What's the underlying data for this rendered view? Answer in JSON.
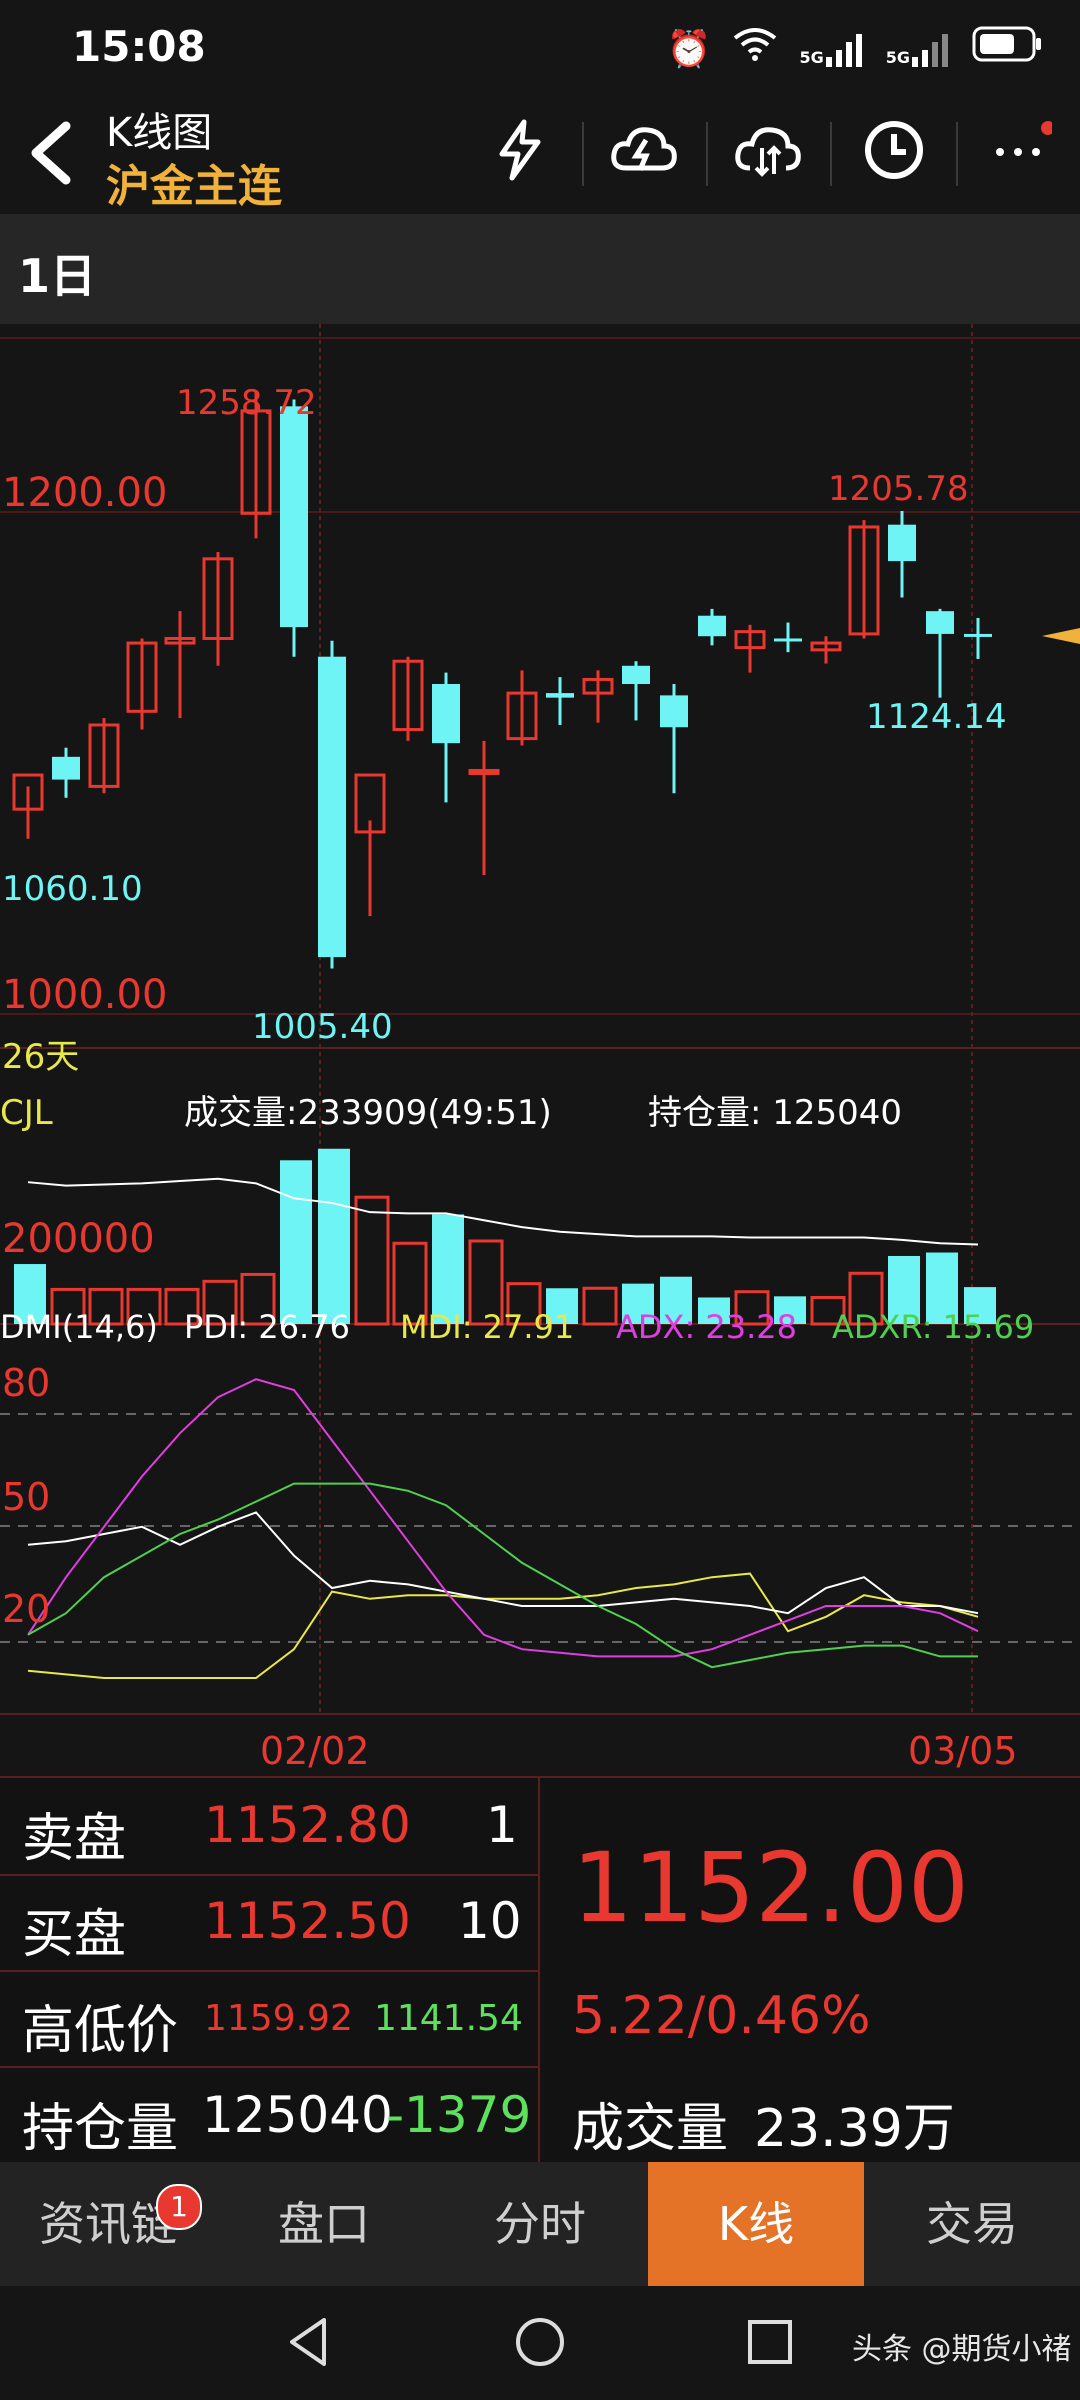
{
  "status_bar": {
    "time": "15:08",
    "network_1": "5G",
    "network_2": "5G"
  },
  "header": {
    "title": "K线图",
    "subtitle": "沪金主连",
    "icons": [
      "flash-icon",
      "cloud-lightning-icon",
      "cloud-sync-icon",
      "clock-icon",
      "more-icon"
    ]
  },
  "period": {
    "label": "1日"
  },
  "main_chart": {
    "labels": {
      "high_top": "1258.72",
      "level_1200": "1200.00",
      "high_recent": "1205.78",
      "low_recent": "1124.14",
      "low_left": "1060.10",
      "level_1000": "1000.00",
      "low_bottom": "1005.40",
      "days": "26天"
    }
  },
  "volume_panel": {
    "name": "CJL",
    "volume_text": "成交量:233909(49:51)",
    "oi_text": "持仓量: 125040",
    "axis_label": "200000"
  },
  "dmi_panel": {
    "name": "DMI(14,6)",
    "pdi": "PDI: 26.76",
    "mdi": "MDI: 27.91",
    "adx": "ADX: 23.28",
    "adxr": "ADXR: 15.69",
    "levels": [
      "80",
      "50",
      "20"
    ]
  },
  "x_axis": {
    "left_date": "02/02",
    "right_date": "03/05"
  },
  "chart_data": [
    {
      "type": "candlestick",
      "title": "",
      "ylim": [
        985,
        1275
      ],
      "candles": [
        {
          "o": 1075,
          "h": 1085,
          "l": 1062,
          "c": 1090,
          "color": "red"
        },
        {
          "o": 1098,
          "h": 1102,
          "l": 1080,
          "c": 1088,
          "color": "cyan"
        },
        {
          "o": 1085,
          "h": 1115,
          "l": 1082,
          "c": 1112,
          "color": "red"
        },
        {
          "o": 1118,
          "h": 1150,
          "l": 1110,
          "c": 1148,
          "color": "red"
        },
        {
          "o": 1148,
          "h": 1162,
          "l": 1115,
          "c": 1150,
          "color": "red"
        },
        {
          "o": 1150,
          "h": 1188,
          "l": 1138,
          "c": 1185,
          "color": "red"
        },
        {
          "o": 1205,
          "h": 1259,
          "l": 1194,
          "c": 1250,
          "color": "red"
        },
        {
          "o": 1252,
          "h": 1255,
          "l": 1142,
          "c": 1155,
          "color": "cyan"
        },
        {
          "o": 1142,
          "h": 1149,
          "l": 1005,
          "c": 1010,
          "color": "cyan"
        },
        {
          "o": 1065,
          "h": 1070,
          "l": 1028,
          "c": 1090,
          "color": "red"
        },
        {
          "o": 1110,
          "h": 1142,
          "l": 1105,
          "c": 1140,
          "color": "red"
        },
        {
          "o": 1130,
          "h": 1135,
          "l": 1078,
          "c": 1104,
          "color": "cyan"
        },
        {
          "o": 1091,
          "h": 1105,
          "l": 1046,
          "c": 1092,
          "color": "red"
        },
        {
          "o": 1106,
          "h": 1136,
          "l": 1103,
          "c": 1126,
          "color": "red"
        },
        {
          "o": 1124,
          "h": 1133,
          "l": 1112,
          "c": 1126,
          "color": "cyan"
        },
        {
          "o": 1126,
          "h": 1136,
          "l": 1113,
          "c": 1132,
          "color": "red"
        },
        {
          "o": 1138,
          "h": 1140,
          "l": 1114,
          "c": 1130,
          "color": "cyan"
        },
        {
          "o": 1125,
          "h": 1130,
          "l": 1082,
          "c": 1111,
          "color": "cyan"
        },
        {
          "o": 1160,
          "h": 1163,
          "l": 1147,
          "c": 1151,
          "color": "cyan"
        },
        {
          "o": 1146,
          "h": 1156,
          "l": 1135,
          "c": 1153,
          "color": "red"
        },
        {
          "o": 1149,
          "h": 1157,
          "l": 1144,
          "c": 1150,
          "color": "cyan"
        },
        {
          "o": 1145,
          "h": 1151,
          "l": 1139,
          "c": 1148,
          "color": "red"
        },
        {
          "o": 1152,
          "h": 1202,
          "l": 1150,
          "c": 1199,
          "color": "red"
        },
        {
          "o": 1200,
          "h": 1206,
          "l": 1168,
          "c": 1184,
          "color": "cyan"
        },
        {
          "o": 1162,
          "h": 1163,
          "l": 1124,
          "c": 1152,
          "color": "cyan"
        },
        {
          "o": 1152,
          "h": 1159,
          "l": 1141,
          "c": 1152,
          "color": "cyan"
        }
      ]
    },
    {
      "type": "bar",
      "title": "成交量",
      "values": [
        52,
        30,
        30,
        30,
        30,
        37,
        43,
        142,
        152,
        110,
        70,
        95,
        72,
        35,
        31,
        31,
        35,
        41,
        23,
        28,
        24,
        23,
        44,
        59,
        62,
        32
      ],
      "colors": [
        "cyan",
        "red",
        "red",
        "red",
        "red",
        "red",
        "red",
        "cyan",
        "cyan",
        "red",
        "red",
        "cyan",
        "red",
        "red",
        "cyan",
        "red",
        "cyan",
        "cyan",
        "cyan",
        "red",
        "cyan",
        "red",
        "red",
        "cyan",
        "cyan",
        "cyan"
      ],
      "line": [
        123,
        120,
        121,
        122,
        124,
        126,
        122,
        109,
        105,
        97,
        96,
        96,
        90,
        84,
        80,
        78,
        76,
        76,
        76,
        75,
        75,
        75,
        75,
        73,
        70,
        69
      ],
      "ylim": [
        0,
        170
      ]
    },
    {
      "type": "line",
      "title": "DMI",
      "ylim": [
        0,
        100
      ],
      "series": [
        {
          "name": "PDI",
          "color": "#e8e84a",
          "values": [
            12,
            11,
            10,
            10,
            10,
            10,
            10,
            18,
            34,
            32,
            33,
            33,
            32,
            32,
            32,
            33,
            35,
            36,
            38,
            39,
            23,
            27,
            33,
            31,
            30,
            27
          ]
        },
        {
          "name": "MDI",
          "color": "#ffffff",
          "values": [
            47,
            48,
            50,
            52,
            47,
            52,
            56,
            44,
            35,
            37,
            36,
            34,
            32,
            30,
            30,
            30,
            31,
            32,
            31,
            30,
            28,
            35,
            38,
            30,
            30,
            28
          ]
        },
        {
          "name": "ADX",
          "color": "#e03ee0",
          "values": [
            22,
            38,
            52,
            66,
            78,
            88,
            93,
            90,
            76,
            62,
            48,
            34,
            22,
            18,
            17,
            16,
            16,
            16,
            18,
            22,
            26,
            30,
            30,
            30,
            28,
            23
          ]
        },
        {
          "name": "ADXR",
          "color": "#50d050",
          "values": [
            22,
            28,
            38,
            44,
            50,
            54,
            59,
            64,
            64,
            64,
            62,
            58,
            50,
            42,
            36,
            30,
            25,
            18,
            13,
            15,
            17,
            18,
            19,
            19,
            16,
            16
          ]
        }
      ]
    }
  ],
  "quote_panel": {
    "ask_label": "卖盘",
    "ask_price": "1152.80",
    "ask_qty": "1",
    "bid_label": "买盘",
    "bid_price": "1152.50",
    "bid_qty": "10",
    "hl_label": "高低价",
    "high": "1159.92",
    "low": "1141.54",
    "oi_label": "持仓量",
    "oi_value": "125040",
    "oi_change": "-1379",
    "last_price": "1152.00",
    "change": "5.22/0.46%",
    "volume_label": "成交量",
    "volume_value": "23.39万"
  },
  "bottom_nav": {
    "items": [
      "资讯链",
      "盘口",
      "分时",
      "K线",
      "交易"
    ],
    "badge": "1",
    "active": "K线"
  },
  "watermark": "头条 @期货小禇"
}
